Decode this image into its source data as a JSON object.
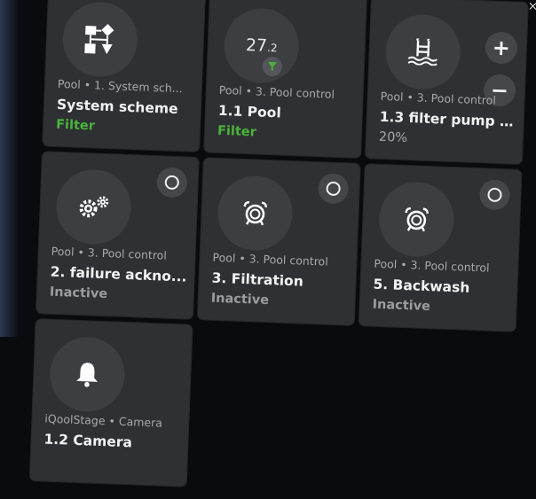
{
  "tiles": [
    {
      "subtitle": "Pool • 1. System sch...",
      "name": "System scheme",
      "status": "Filter",
      "status_color": "#49b33a",
      "icon": "scheme-icon"
    },
    {
      "temp_main": "27",
      "temp_decimal": ".2",
      "subtitle": "Pool • 3. Pool control",
      "name": "1.1 Pool",
      "status": "Filter",
      "status_color": "#49b33a",
      "icon": "filter-icon"
    },
    {
      "subtitle": "Pool • 3. Pool control",
      "name": "1.3 filter pump s...",
      "status": "20%",
      "plus": "+",
      "minus": "−",
      "icon": "pool-ladder-icon"
    },
    {
      "subtitle": "Pool • 3. Pool control",
      "name": "2. failure ackno...",
      "status": "Inactive",
      "icon": "gears-icon"
    },
    {
      "subtitle": "Pool • 3. Pool control",
      "name": "3. Filtration",
      "status": "Inactive",
      "icon": "alarm-clock-icon"
    },
    {
      "subtitle": "Pool • 3. Pool control",
      "name": "5. Backwash",
      "status": "Inactive",
      "icon": "alarm-clock-icon"
    },
    {
      "subtitle": "iQoolStage • Camera",
      "name": "1.2 Camera",
      "icon": "bell-icon"
    }
  ],
  "close_glyph": "×"
}
